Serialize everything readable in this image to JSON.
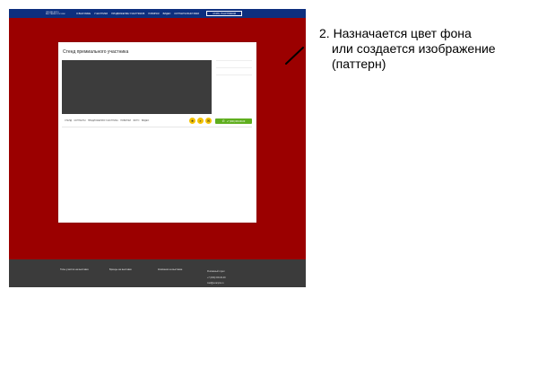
{
  "header": {
    "logo_line1": "ONLINE EXPO",
    "logo_line2": "ВЫСТАВКИ РОССИИ",
    "nav": [
      "О ВЫСТАВКЕ",
      "УЧАСТНИКИ",
      "ПРОДВИЖЕНИЕ УЧАСТНИКОВ",
      "НОВИНКИ",
      "ВИДЕО",
      "КОНТАКТЫ ВЫСТАВКИ"
    ],
    "cta": "СТАТЬ УЧАСТНИКОМ"
  },
  "stand": {
    "title": "Стенд премиального участника",
    "menu": [
      "СТЕНД",
      "КОНТАКТЫ",
      "ПРЕДЛОЖЕНИЯ УЧАСТНИКА",
      "НОВИНКИ",
      "ФОТО",
      "ВИДЕО"
    ],
    "actions": [
      {
        "icon": "star-icon",
        "glyph": "★"
      },
      {
        "icon": "search-icon",
        "glyph": "⌕"
      },
      {
        "icon": "chat-icon",
        "glyph": "✉"
      }
    ],
    "call_label": "+7 (000) 000-00-00",
    "call_icon_glyph": "✆"
  },
  "footer": {
    "links": [
      "Типы участия на выставке",
      "Бренды на выставке",
      "Компании на выставке"
    ],
    "contact_title": "Рекламный отдел",
    "phone": "+7 (000) 000-00-00",
    "email": "mail@example.ru"
  },
  "annotation": {
    "line1": "2. Назначается цвет фона",
    "line2": "или создается изображение",
    "line3": "(паттерн)"
  },
  "colors": {
    "page_background": "#9b0000",
    "header": "#0d2f7e",
    "footer": "#3b3b3b",
    "accent_yellow": "#f3c200",
    "accent_green": "#5fae1e"
  }
}
